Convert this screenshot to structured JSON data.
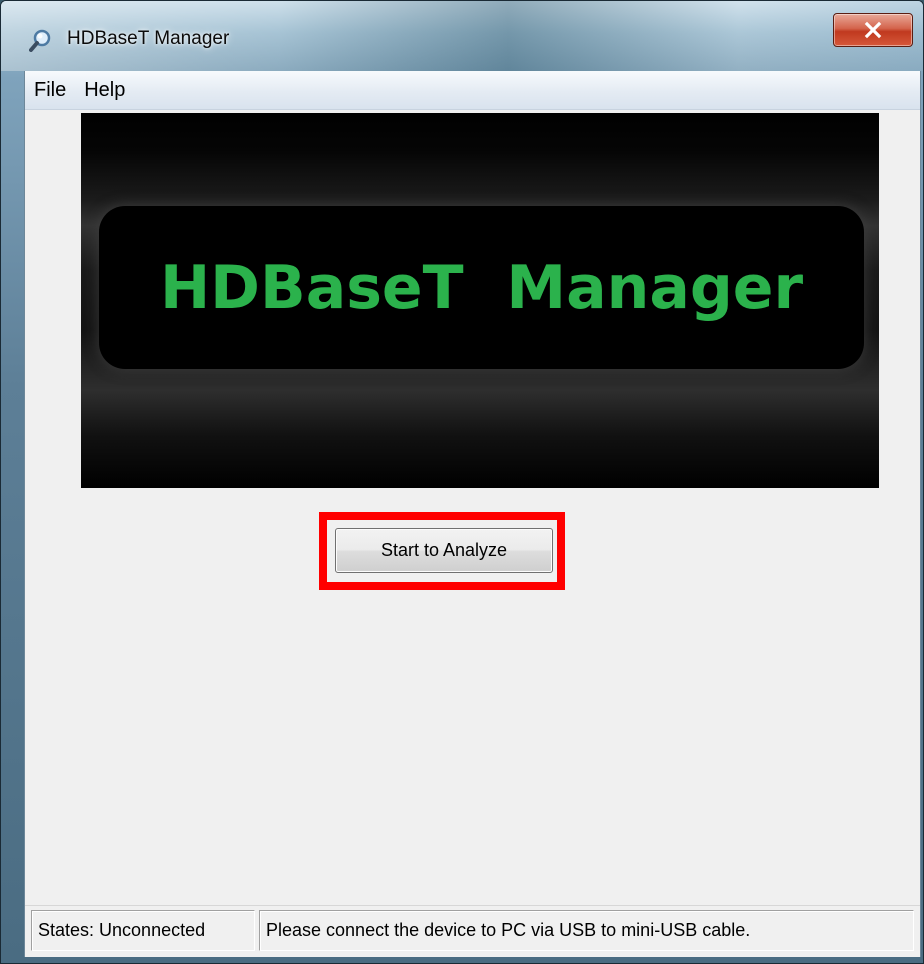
{
  "window": {
    "title": "HDBaseT Manager",
    "title_icon": "magnifier-icon",
    "close_icon": "close-icon"
  },
  "menubar": {
    "items": [
      {
        "label": "File"
      },
      {
        "label": "Help"
      }
    ]
  },
  "banner": {
    "title": "HDBaseT Manager",
    "title_color": "#2bb24c"
  },
  "main": {
    "analyze_button_label": "Start to Analyze",
    "highlight_color": "#ff0000"
  },
  "statusbar": {
    "state": "States: Unconnected",
    "message": "Please connect the device to PC via USB to mini-USB cable."
  }
}
